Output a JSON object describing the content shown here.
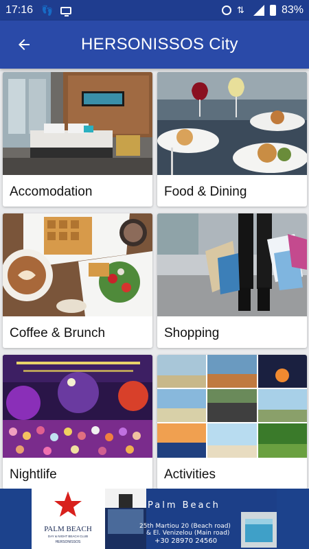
{
  "status_bar": {
    "time": "17:16",
    "battery": "83%",
    "icons": [
      "step-counter-icon",
      "cast-monitor-icon",
      "alarm-icon",
      "data-arrows-icon",
      "signal-icon",
      "battery-icon"
    ]
  },
  "app_bar": {
    "title": "HERSONISSOS City",
    "back_icon": "arrow-left-icon"
  },
  "categories": [
    {
      "label": "Accomodation"
    },
    {
      "label": "Food & Dining"
    },
    {
      "label": "Coffee & Brunch"
    },
    {
      "label": "Shopping"
    },
    {
      "label": "Nightlife"
    },
    {
      "label": "Activities"
    }
  ],
  "ad": {
    "logo_title": "PALM BEACH",
    "logo_sub": "DAY & NIGHT BEACH CLUB",
    "logo_place": "HERSONISSOS",
    "name": "Palm Beach",
    "address1": "25th Martiou 20 (Beach road)",
    "address2": "& El. Venizelou (Main road)",
    "phone": "+30 28970 24560"
  },
  "colors": {
    "status_bar": "#1f3d8f",
    "app_bar": "#2a4aa8",
    "background": "#e9eaec",
    "ad_background": "#1c428c"
  }
}
